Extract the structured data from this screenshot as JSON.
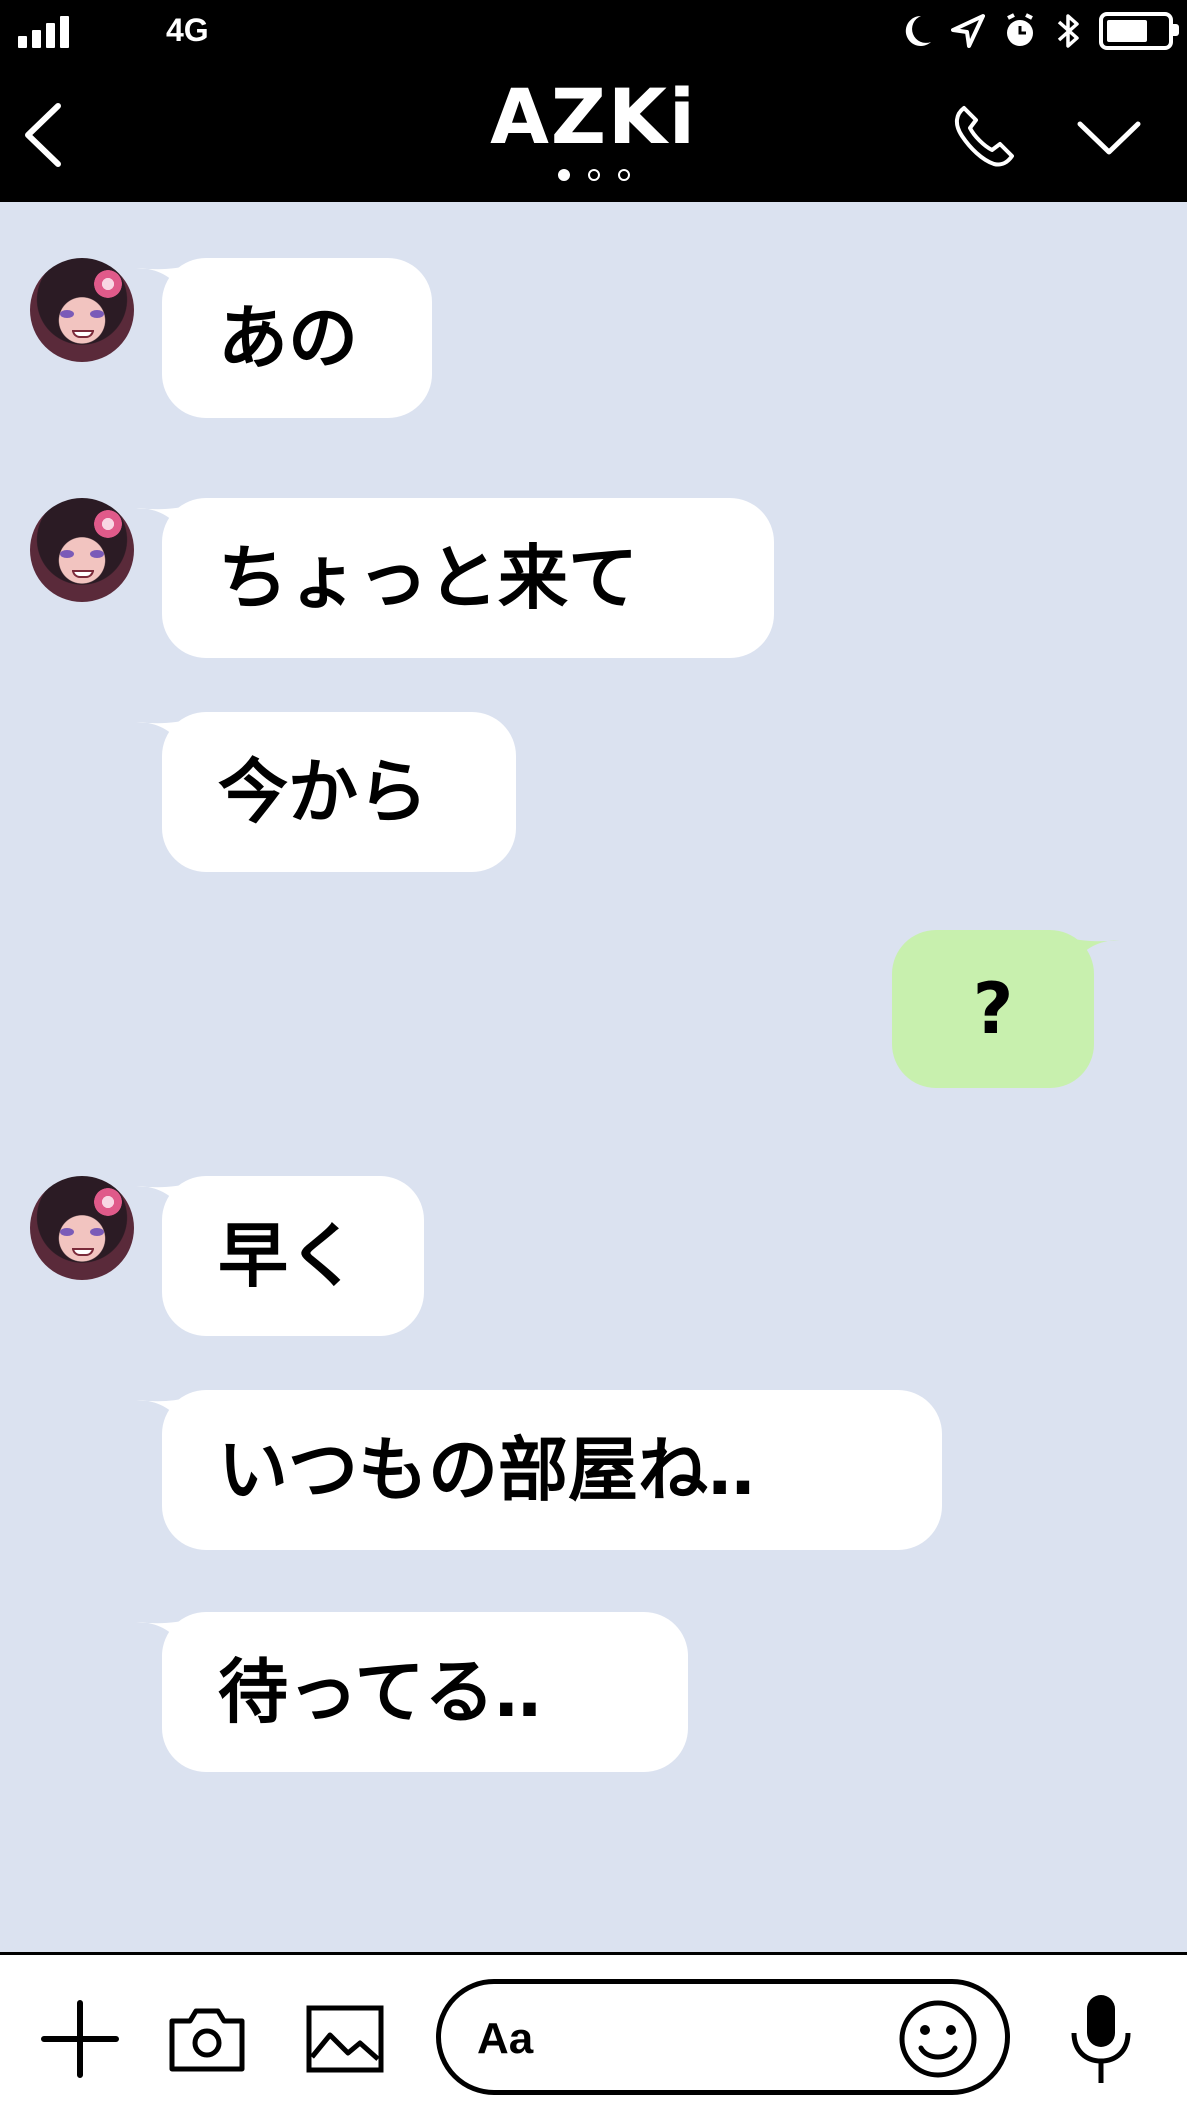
{
  "status_bar": {
    "network": "4G",
    "icons": [
      "signal-icon",
      "moon-icon",
      "location-arrow-icon",
      "alarm-icon",
      "bluetooth-icon",
      "battery-icon"
    ]
  },
  "header": {
    "contact_name": "AZKi",
    "page_dots": 3,
    "active_page": 1,
    "icons": [
      "back-chevron-icon",
      "phone-icon",
      "chevron-down-icon"
    ]
  },
  "messages": [
    {
      "sender": "other",
      "text": "あの",
      "show_avatar": true
    },
    {
      "sender": "other",
      "text": "ちょっと来て",
      "show_avatar": true
    },
    {
      "sender": "other",
      "text": "今から",
      "show_avatar": false
    },
    {
      "sender": "me",
      "text": "?",
      "show_avatar": false
    },
    {
      "sender": "other",
      "text": "早く",
      "show_avatar": true
    },
    {
      "sender": "other",
      "text": "いつもの部屋ね‥",
      "show_avatar": false
    },
    {
      "sender": "other",
      "text": "待ってる‥",
      "show_avatar": false
    }
  ],
  "composer": {
    "placeholder": "Aa",
    "icons": [
      "plus-icon",
      "camera-icon",
      "image-icon",
      "smiley-icon",
      "microphone-icon"
    ]
  },
  "colors": {
    "background": "#dbe2f0",
    "header": "#000000",
    "bubble_other": "#ffffff",
    "bubble_me": "#c8f0ae"
  }
}
